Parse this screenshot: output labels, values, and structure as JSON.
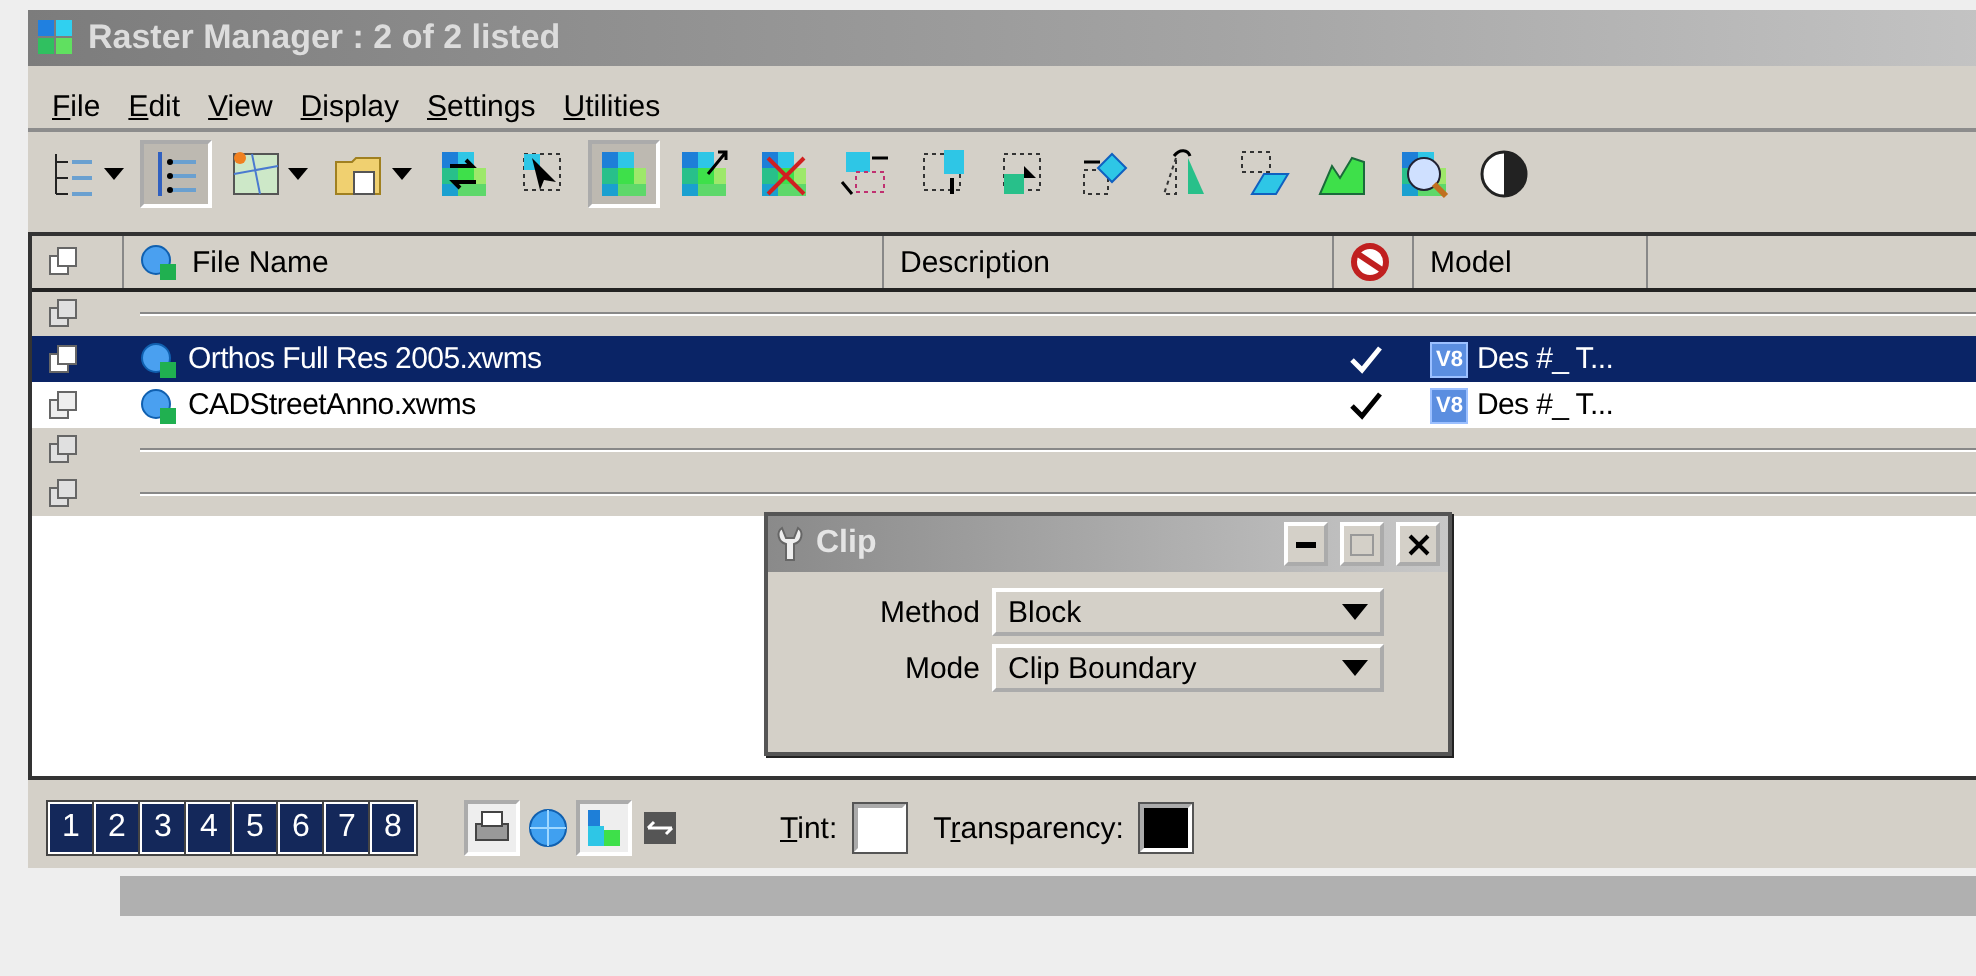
{
  "window": {
    "title": "Raster Manager : 2 of 2 listed"
  },
  "menu": [
    {
      "access_key": "F",
      "rest": "ile"
    },
    {
      "access_key": "E",
      "rest": "dit"
    },
    {
      "access_key": "V",
      "rest": "iew"
    },
    {
      "access_key": "D",
      "rest": "isplay"
    },
    {
      "access_key": "S",
      "rest": "ettings"
    },
    {
      "access_key": "U",
      "rest": "tilities"
    }
  ],
  "toolbar": [
    {
      "kind": "tree",
      "pressed": false,
      "dropdown": true
    },
    {
      "kind": "sorted-list",
      "pressed": true,
      "dropdown": false
    },
    {
      "kind": "map",
      "pressed": false,
      "dropdown": true
    },
    {
      "kind": "folder",
      "pressed": false,
      "dropdown": true
    },
    {
      "kind": "swap",
      "pressed": false,
      "dropdown": false
    },
    {
      "kind": "select",
      "pressed": false,
      "dropdown": false
    },
    {
      "kind": "raster",
      "pressed": true,
      "dropdown": false
    },
    {
      "kind": "raster-arrow",
      "pressed": false,
      "dropdown": false
    },
    {
      "kind": "raster-delete",
      "pressed": false,
      "dropdown": false
    },
    {
      "kind": "rotate",
      "pressed": false,
      "dropdown": false
    },
    {
      "kind": "move",
      "pressed": false,
      "dropdown": false
    },
    {
      "kind": "corner",
      "pressed": false,
      "dropdown": false
    },
    {
      "kind": "diamond",
      "pressed": false,
      "dropdown": false
    },
    {
      "kind": "mirror",
      "pressed": false,
      "dropdown": false
    },
    {
      "kind": "skew",
      "pressed": false,
      "dropdown": false
    },
    {
      "kind": "terrain",
      "pressed": false,
      "dropdown": false
    },
    {
      "kind": "zoom",
      "pressed": false,
      "dropdown": false
    },
    {
      "kind": "contrast",
      "pressed": false,
      "dropdown": false
    }
  ],
  "table": {
    "columns": [
      "File Name",
      "Description",
      "Model"
    ],
    "rows": [
      {
        "kind": "group"
      },
      {
        "kind": "file",
        "name": "Orthos Full Res 2005.xwms",
        "displayed": true,
        "badge": "V8",
        "model": "Des #_ T...",
        "selected": true
      },
      {
        "kind": "file",
        "name": "CADStreetAnno.xwms",
        "displayed": true,
        "badge": "V8",
        "model": "Des #_ T...",
        "selected": false
      },
      {
        "kind": "group"
      },
      {
        "kind": "group"
      }
    ]
  },
  "clip_dialog": {
    "title": "Clip",
    "fields": [
      {
        "label": "Method",
        "value": "Block"
      },
      {
        "label": "Mode",
        "value": "Clip Boundary"
      }
    ]
  },
  "footer": {
    "views": [
      {
        "label": "1",
        "on": true
      },
      {
        "label": "2",
        "on": true
      },
      {
        "label": "3",
        "on": true
      },
      {
        "label": "4",
        "on": true
      },
      {
        "label": "5",
        "on": true
      },
      {
        "label": "6",
        "on": true
      },
      {
        "label": "7",
        "on": true
      },
      {
        "label": "8",
        "on": true
      }
    ],
    "tools": [
      {
        "kind": "printer",
        "pressed": true
      },
      {
        "kind": "globe",
        "pressed": false
      },
      {
        "kind": "raster",
        "pressed": true
      },
      {
        "kind": "arrows",
        "pressed": false
      }
    ],
    "tint": {
      "access_key": "T",
      "rest": "int:",
      "color": "#ffffff"
    },
    "transparency": {
      "before": "T",
      "access_key": "r",
      "rest": "ansparency:",
      "color": "#000000"
    }
  }
}
